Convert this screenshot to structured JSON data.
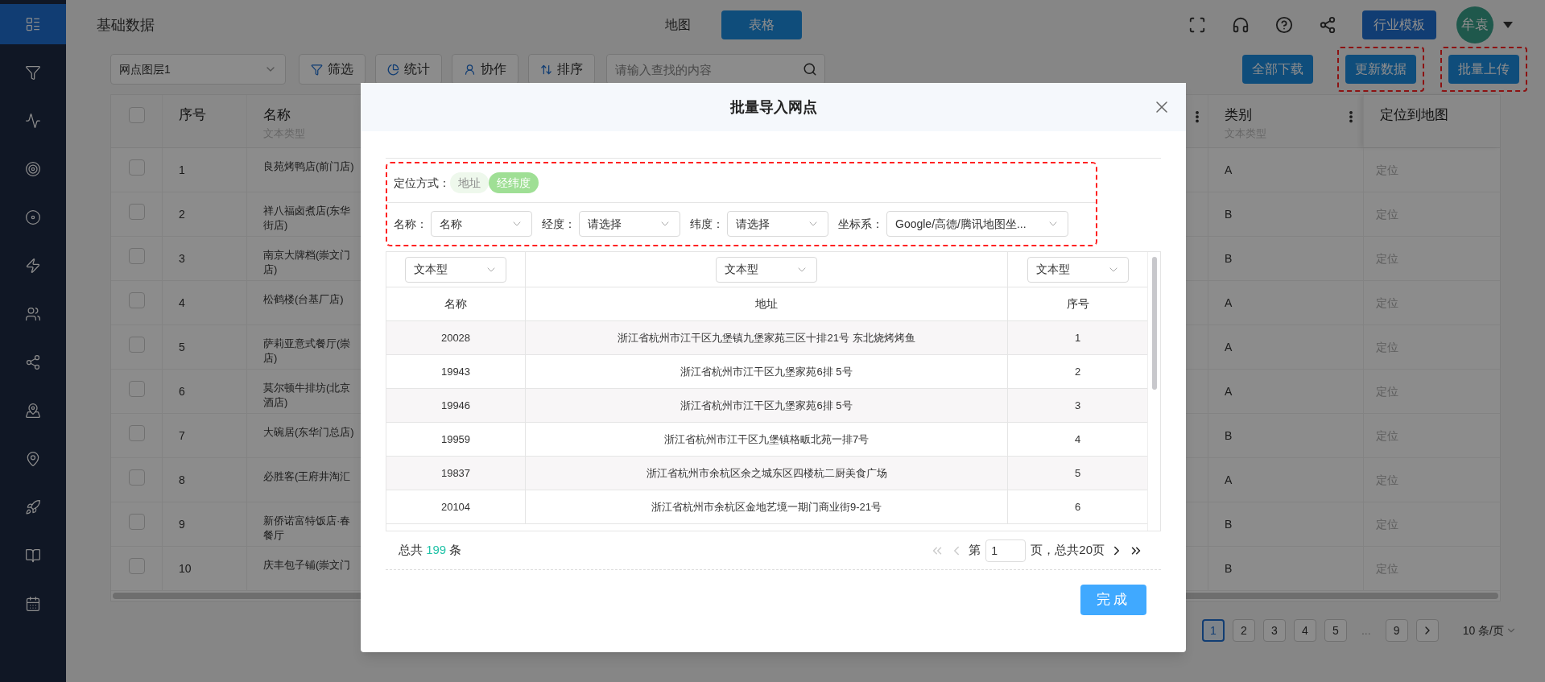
{
  "sidebar": {
    "items": [
      {
        "selected": true
      },
      {
        "selected": false
      },
      {
        "selected": false
      },
      {
        "selected": false
      },
      {
        "selected": false
      },
      {
        "selected": false
      },
      {
        "selected": false
      },
      {
        "selected": false
      },
      {
        "selected": false
      },
      {
        "selected": false
      },
      {
        "selected": false
      },
      {
        "selected": false
      },
      {
        "selected": false
      }
    ]
  },
  "header": {
    "title": "基础数据",
    "view_tabs": [
      {
        "label": "地图",
        "selected": false
      },
      {
        "label": "表格",
        "selected": true
      }
    ],
    "template_button": "行业模板",
    "avatar": "牟袁"
  },
  "toolbar": {
    "layer_select": "网点图层1",
    "buttons": [
      "筛选",
      "统计",
      "协作",
      "排序"
    ],
    "search": {
      "placeholder": "请输入查找的内容"
    },
    "actions": [
      {
        "label": "全部下载",
        "annotated": false
      },
      {
        "label": "更新数据",
        "annotated": true
      },
      {
        "label": "批量上传",
        "annotated": true
      }
    ]
  },
  "table": {
    "all_checked": false,
    "index_column": "序号",
    "name_column": {
      "label": "名称",
      "type": "文本类型"
    },
    "category_column": {
      "label": "类别",
      "type": "文本类型"
    },
    "locate_column": "定位到地图",
    "rows": [
      {
        "checked": false,
        "index": "1",
        "name_lines": [
          "良苑烤鸭店(前门店)"
        ],
        "category": "A",
        "action": "定位"
      },
      {
        "checked": false,
        "index": "2",
        "name_lines": [
          "祥八福卤煮店(东华",
          "街店)"
        ],
        "category": "B",
        "action": "定位"
      },
      {
        "checked": false,
        "index": "3",
        "name_lines": [
          "南京大牌档(崇文门",
          "店)"
        ],
        "category": "B",
        "action": "定位"
      },
      {
        "checked": false,
        "index": "4",
        "name_lines": [
          "松鹤楼(台基厂店)"
        ],
        "category": "A",
        "action": "定位"
      },
      {
        "checked": false,
        "index": "5",
        "name_lines": [
          "萨莉亚意式餐厅(崇",
          "店)"
        ],
        "category": "A",
        "action": "定位"
      },
      {
        "checked": false,
        "index": "6",
        "name_lines": [
          "莫尔顿牛排坊(北京",
          "酒店)"
        ],
        "category": "A",
        "action": "定位"
      },
      {
        "checked": false,
        "index": "7",
        "name_lines": [
          "大碗居(东华门总店)"
        ],
        "category": "B",
        "action": "定位"
      },
      {
        "checked": false,
        "index": "8",
        "name_lines": [
          "必胜客(王府井淘汇"
        ],
        "category": "A",
        "action": "定位"
      },
      {
        "checked": false,
        "index": "9",
        "name_lines": [
          "新侨诺富特饭店·春",
          "餐厅"
        ],
        "category": "B",
        "action": "定位"
      },
      {
        "checked": false,
        "index": "10",
        "name_lines": [
          "庆丰包子铺(崇文门"
        ],
        "category": "B",
        "action": "定位"
      }
    ]
  },
  "pagination": {
    "pages": [
      {
        "kind": "page",
        "label": "1",
        "selected": true
      },
      {
        "kind": "page",
        "label": "2",
        "selected": false
      },
      {
        "kind": "page",
        "label": "3",
        "selected": false
      },
      {
        "kind": "page",
        "label": "4",
        "selected": false
      },
      {
        "kind": "page",
        "label": "5",
        "selected": false
      },
      {
        "kind": "ellipsis",
        "label": "..."
      },
      {
        "kind": "page",
        "label": "9",
        "selected": false
      }
    ],
    "page_size": "10 条/页"
  },
  "modal": {
    "title": "批量导入网点",
    "settings_annotated": true,
    "locate_mode": {
      "label": "定位方式：",
      "options": [
        {
          "label": "地址",
          "selected": false
        },
        {
          "label": "经纬度",
          "selected": true
        }
      ]
    },
    "fields": [
      {
        "label": "名称：",
        "value": "名称"
      },
      {
        "label": "经度：",
        "value": "请选择"
      },
      {
        "label": "纬度：",
        "value": "请选择"
      },
      {
        "label": "坐标系：",
        "value": "Google/高德/腾讯地图坐..."
      }
    ],
    "preview": {
      "column_types": [
        "文本型",
        "文本型",
        "文本型"
      ],
      "columns": [
        "名称",
        "地址",
        "序号"
      ],
      "rows": [
        [
          "20028",
          "浙江省杭州市江干区九堡镇九堡家苑三区十排21号 东北烧烤烤鱼",
          "1"
        ],
        [
          "19943",
          "浙江省杭州市江干区九堡家苑6排 5号",
          "2"
        ],
        [
          "19946",
          "浙江省杭州市江干区九堡家苑6排 5号",
          "3"
        ],
        [
          "19959",
          "浙江省杭州市江干区九堡镇格畈北苑一排7号",
          "4"
        ],
        [
          "19837",
          "浙江省杭州市余杭区余之城东区四楼杭二厨美食广场",
          "5"
        ],
        [
          "20104",
          "浙江省杭州市余杭区金地艺境一期门商业街9-21号",
          "6"
        ]
      ]
    },
    "total": {
      "prefix": "总共",
      "count": "199",
      "suffix": "条"
    },
    "pager": {
      "prefix": "第",
      "page": "1",
      "suffix": "页，总共20页"
    },
    "done_button": "完成"
  }
}
